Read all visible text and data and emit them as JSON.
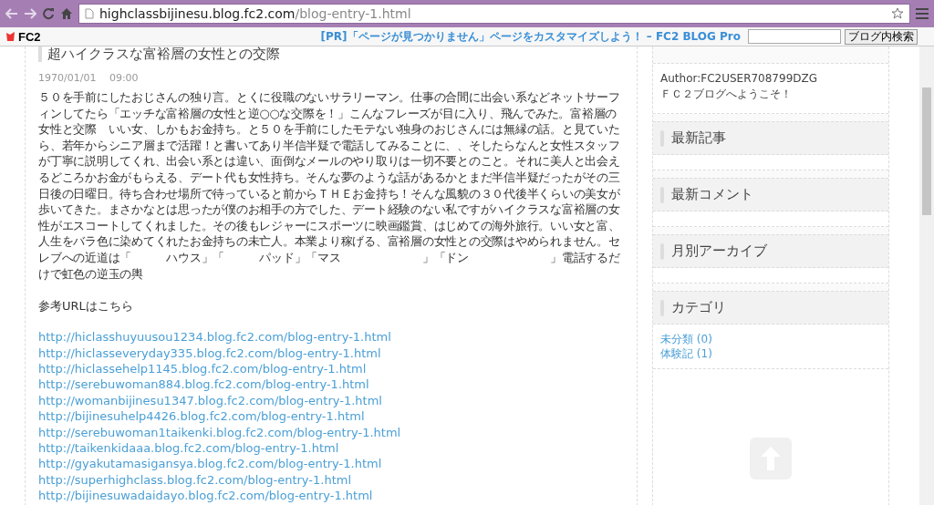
{
  "browser": {
    "url_host": "highclassbijinesu.blog.fc2.com",
    "url_path": "/blog-entry-1.html"
  },
  "fc2_bar": {
    "logo": "FC2",
    "promo": "[PR]「ページが見つかりません」ページをカスタマイズしよう！ – FC2 BLOG Pro",
    "search_button": "ブログ内検索"
  },
  "entry": {
    "title": "超ハイクラスな富裕層の女性との交際",
    "date": "1970/01/01　 09:00",
    "body": "５０を手前にしたおじさんの独り言。とくに役職のないサラリーマン。仕事の合間に出会い系などネットサーフィンしてたら「エッチな富裕層の女性と逆○○な交際を！」こんなフレーズが目に入り、飛んでみた。富裕層の女性と交際　いい女、しかもお金持ち。と５０を手前にしたモテない独身のおじさんには無縁の話。と見ていたら、若年からシニア層まで活躍！と書いてあり半信半疑で電話してみることに、、そしたらなんと女性スタッフが丁寧に説明してくれ、出会い系とは違い、面倒なメールのやり取りは一切不要とのこと。それに美人と出会えるどころかお金がもらえる、デート代も女性持ち。そんな夢のような話があるかとまだ半信半疑だったがその三日後の日曜日。待ち合わせ場所で待っていると前からＴＨＥお金持ち！そんな風貌の３０代後半くらいの美女が歩いてきた。まさかなとは思ったが僕のお相手の方でした、デート経験のない私ですがハイクラスな富裕層の女性がエスコートしてくれました。その後もレジャーにスポーツに映画鑑賞、はじめての海外旅行。いい女と富、人生をバラ色に染めてくれたお金持ちの未亡人。本業より稼げる、富裕層の女性との交際はやめられません。セレブへの近道は「　　　ハウス」「　　　パッド」「マス　　　　　　　」「ドン　　　　　　　」電話するだけで虹色の逆玉の輿",
    "reference_label": "参考URLはこちら",
    "links": [
      "http://hiclasshuyuusou1234.blog.fc2.com/blog-entry-1.html",
      "http://hiclasseveryday335.blog.fc2.com/blog-entry-1.html",
      "http://hiclassehelp1145.blog.fc2.com/blog-entry-1.html",
      "http://serebuwoman884.blog.fc2.com/blog-entry-1.html",
      "http://womanbijinesu1347.blog.fc2.com/blog-entry-1.html",
      "http://bijinesuhelp4426.blog.fc2.com/blog-entry-1.html",
      "http://serebuwoman1taikenki.blog.fc2.com/blog-entry-1.html",
      "http://taikenkidaaa.blog.fc2.com/blog-entry-1.html",
      "http://gyakutamasigansya.blog.fc2.com/blog-entry-1.html",
      "http://superhighclass.blog.fc2.com/blog-entry-1.html",
      "http://bijinesuwadaidayo.blog.fc2.com/blog-entry-1.html"
    ]
  },
  "sidebar": {
    "author": "Author:FC2USER708799DZG",
    "welcome": "ＦＣ２ブログへようこそ！",
    "sections": [
      {
        "heading": "最新記事"
      },
      {
        "heading": "最新コメント"
      },
      {
        "heading": "月別アーカイブ"
      },
      {
        "heading": "カテゴリ",
        "items": [
          "未分類 (0)",
          "体験記 (1)"
        ]
      }
    ]
  }
}
